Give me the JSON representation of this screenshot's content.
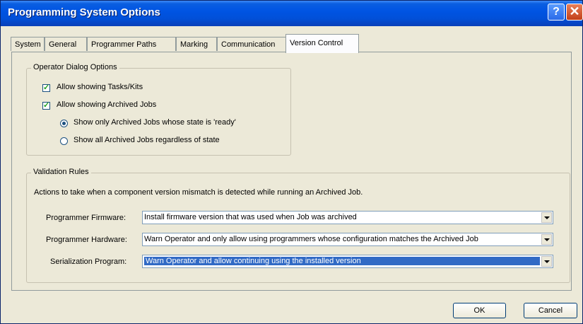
{
  "window": {
    "title": "Programming System Options",
    "help_glyph": "?",
    "close_glyph": "✕"
  },
  "tabs": [
    {
      "label": "System"
    },
    {
      "label": "General"
    },
    {
      "label": "Programmer Paths"
    },
    {
      "label": "Marking"
    },
    {
      "label": "Communication"
    },
    {
      "label": "Version Control",
      "active": true
    }
  ],
  "operator_dialog": {
    "title": "Operator Dialog Options",
    "allow_tasks": {
      "label": "Allow showing Tasks/Kits",
      "checked": true
    },
    "allow_archived": {
      "label": "Allow showing Archived Jobs",
      "checked": true
    },
    "radio_ready": {
      "label": "Show only Archived Jobs whose state is 'ready'",
      "selected": true
    },
    "radio_all": {
      "label": "Show all Archived Jobs regardless of state",
      "selected": false
    }
  },
  "validation": {
    "title": "Validation Rules",
    "description": "Actions to take when a component version mismatch is detected while running an Archived Job.",
    "firmware": {
      "label": "Programmer Firmware:",
      "value": "Install firmware version that was used when Job was archived"
    },
    "hardware": {
      "label": "Programmer Hardware:",
      "value": "Warn Operator and only allow using programmers whose configuration matches the Archived Job"
    },
    "serialization": {
      "label": "Serialization Program:",
      "value": "Warn Operator and allow continuing using the installed version"
    }
  },
  "buttons": {
    "ok": "OK",
    "cancel": "Cancel"
  },
  "colors": {
    "title_bar": "#0054e3",
    "selection": "#316ac5",
    "dialog_bg": "#ece9d8"
  }
}
